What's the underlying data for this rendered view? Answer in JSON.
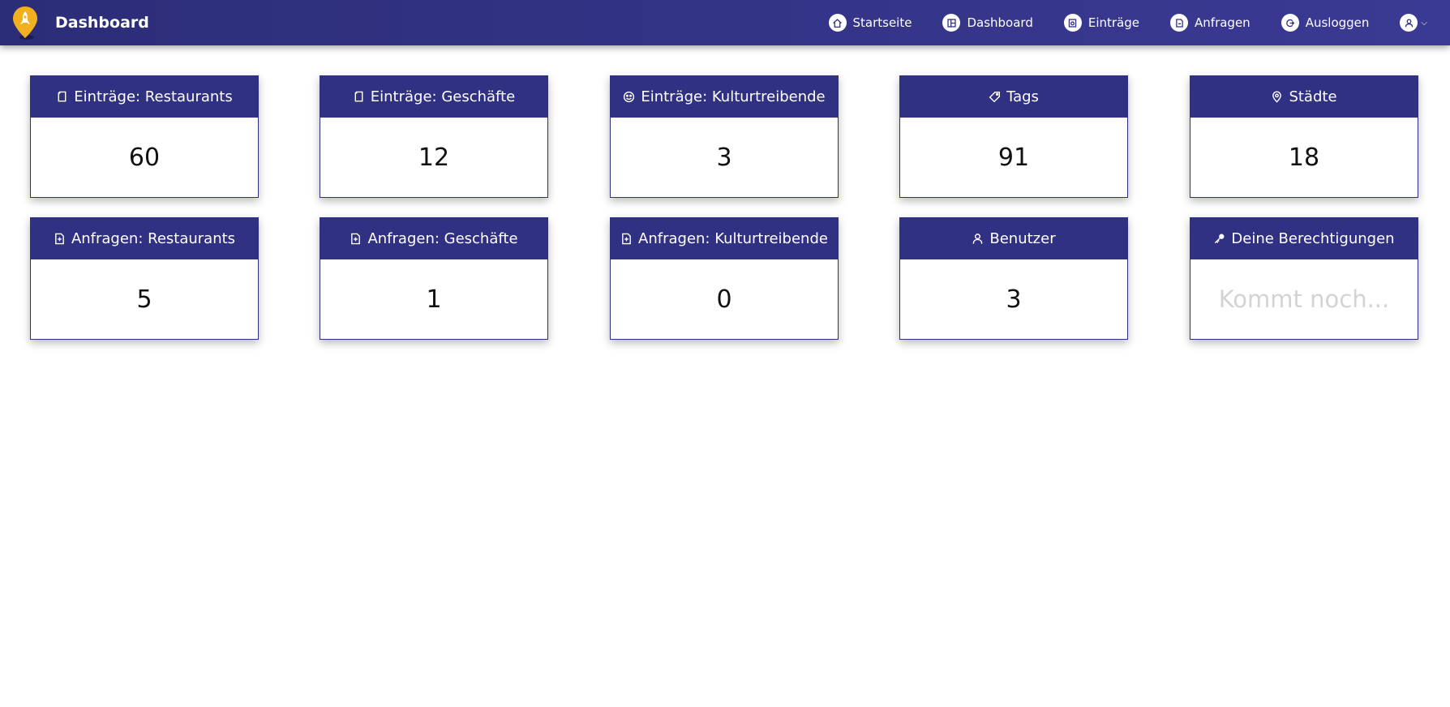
{
  "app": {
    "title": "Dashboard"
  },
  "nav": [
    {
      "label": "Startseite",
      "icon": "home-icon"
    },
    {
      "label": "Dashboard",
      "icon": "dashboard-icon"
    },
    {
      "label": "Einträge",
      "icon": "entries-icon"
    },
    {
      "label": "Anfragen",
      "icon": "requests-icon"
    },
    {
      "label": "Ausloggen",
      "icon": "logout-icon"
    }
  ],
  "user_menu": {
    "icon": "user-icon"
  },
  "cards": [
    {
      "title": "Einträge: Restaurants",
      "value": "60",
      "icon": "document-icon"
    },
    {
      "title": "Einträge: Geschäfte",
      "value": "12",
      "icon": "document-icon"
    },
    {
      "title": "Einträge: Kulturtreibende",
      "value": "3",
      "icon": "smiley-icon"
    },
    {
      "title": "Tags",
      "value": "91",
      "icon": "tag-icon"
    },
    {
      "title": "Städte",
      "value": "18",
      "icon": "location-pin-icon"
    },
    {
      "title": "Anfragen: Restaurants",
      "value": "5",
      "icon": "document-plus-icon"
    },
    {
      "title": "Anfragen: Geschäfte",
      "value": "1",
      "icon": "document-plus-icon"
    },
    {
      "title": "Anfragen: Kulturtreibende",
      "value": "0",
      "icon": "document-plus-icon"
    },
    {
      "title": "Benutzer",
      "value": "3",
      "icon": "user-icon"
    },
    {
      "title": "Deine Berechtigungen",
      "value": "Kommt noch...",
      "icon": "key-icon"
    }
  ],
  "colors": {
    "primary": "#303182",
    "placeholder": "#d3d3d3",
    "logo": "#f2b01e"
  }
}
